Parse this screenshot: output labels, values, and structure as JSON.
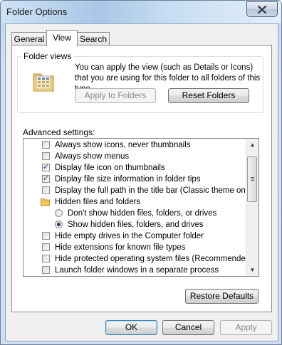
{
  "window": {
    "title": "Folder Options"
  },
  "tabs": [
    {
      "label": "General"
    },
    {
      "label": "View"
    },
    {
      "label": "Search"
    }
  ],
  "folder_views": {
    "heading": "Folder views",
    "description": "You can apply the view (such as Details or Icons) that you are using for this folder to all folders of this type.",
    "apply_button": "Apply to Folders",
    "reset_button": "Reset Folders"
  },
  "advanced": {
    "heading": "Advanced settings:",
    "items": [
      {
        "kind": "checkbox",
        "label": "Always show icons, never thumbnails",
        "checked": false
      },
      {
        "kind": "checkbox",
        "label": "Always show menus",
        "checked": false
      },
      {
        "kind": "checkbox",
        "label": "Display file icon on thumbnails",
        "checked": true
      },
      {
        "kind": "checkbox",
        "label": "Display file size information in folder tips",
        "checked": true
      },
      {
        "kind": "checkbox",
        "label": "Display the full path in the title bar (Classic theme only)",
        "checked": false
      },
      {
        "kind": "folder",
        "label": "Hidden files and folders"
      },
      {
        "kind": "radio",
        "label": "Don't show hidden files, folders, or drives",
        "checked": false
      },
      {
        "kind": "radio",
        "label": "Show hidden files, folders, and drives",
        "checked": true
      },
      {
        "kind": "checkbox",
        "label": "Hide empty drives in the Computer folder",
        "checked": false
      },
      {
        "kind": "checkbox",
        "label": "Hide extensions for known file types",
        "checked": false
      },
      {
        "kind": "checkbox",
        "label": "Hide protected operating system files (Recommended)",
        "checked": false
      },
      {
        "kind": "checkbox",
        "label": "Launch folder windows in a separate process",
        "checked": false
      }
    ]
  },
  "buttons": {
    "restore": "Restore Defaults",
    "ok": "OK",
    "cancel": "Cancel",
    "apply": "Apply"
  },
  "colors": {
    "accent": "#3c7fb1",
    "check": "#1c3f7a"
  }
}
